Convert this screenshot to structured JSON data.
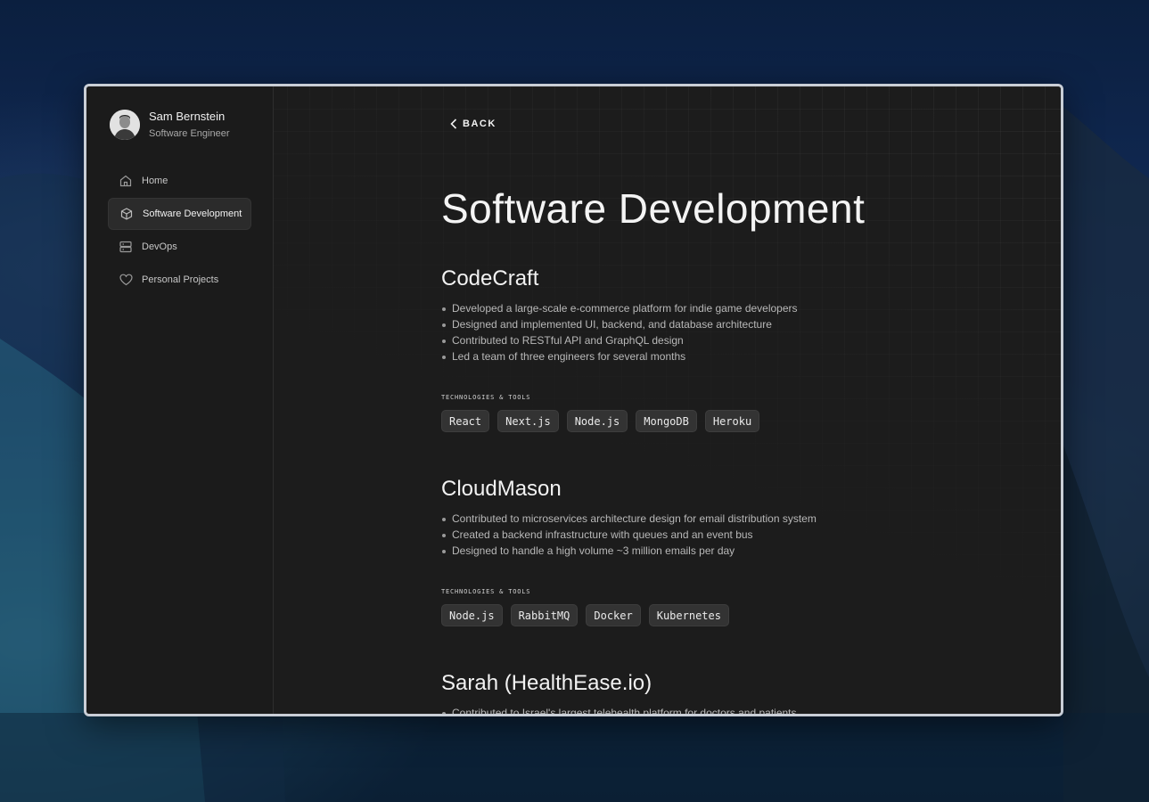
{
  "profile": {
    "name": "Sam Bernstein",
    "role": "Software Engineer"
  },
  "nav": {
    "items": [
      {
        "label": "Home",
        "icon": "home-icon"
      },
      {
        "label": "Software Development",
        "icon": "cube-icon",
        "active": true
      },
      {
        "label": "DevOps",
        "icon": "server-icon"
      },
      {
        "label": "Personal Projects",
        "icon": "heart-icon"
      }
    ]
  },
  "main": {
    "back_label": "BACK",
    "title": "Software Development",
    "tech_label": "TECHNOLOGIES & TOOLS",
    "projects": [
      {
        "name": "CodeCraft",
        "bullets": [
          "Developed a large-scale e-commerce platform for indie game developers",
          "Designed and implemented UI, backend, and database architecture",
          "Contributed to RESTful API and GraphQL design",
          "Led a team of three engineers for several months"
        ],
        "tags": [
          "React",
          "Next.js",
          "Node.js",
          "MongoDB",
          "Heroku"
        ]
      },
      {
        "name": "CloudMason",
        "bullets": [
          "Contributed to microservices architecture design for email distribution system",
          "Created a backend infrastructure with queues and an event bus",
          "Designed to handle a high volume ~3 million emails per day"
        ],
        "tags": [
          "Node.js",
          "RabbitMQ",
          "Docker",
          "Kubernetes"
        ]
      },
      {
        "name": "Sarah (HealthEase.io)",
        "bullets": [
          "Contributed to Israel's largest telehealth platform for doctors and patients"
        ]
      }
    ]
  },
  "colors": {
    "window_bg": "#1c1c1c",
    "sidebar_bg": "#1b1b1b",
    "tag_bg": "#333333",
    "text_primary": "#f2f2f2",
    "text_secondary": "#b8b8b8"
  }
}
